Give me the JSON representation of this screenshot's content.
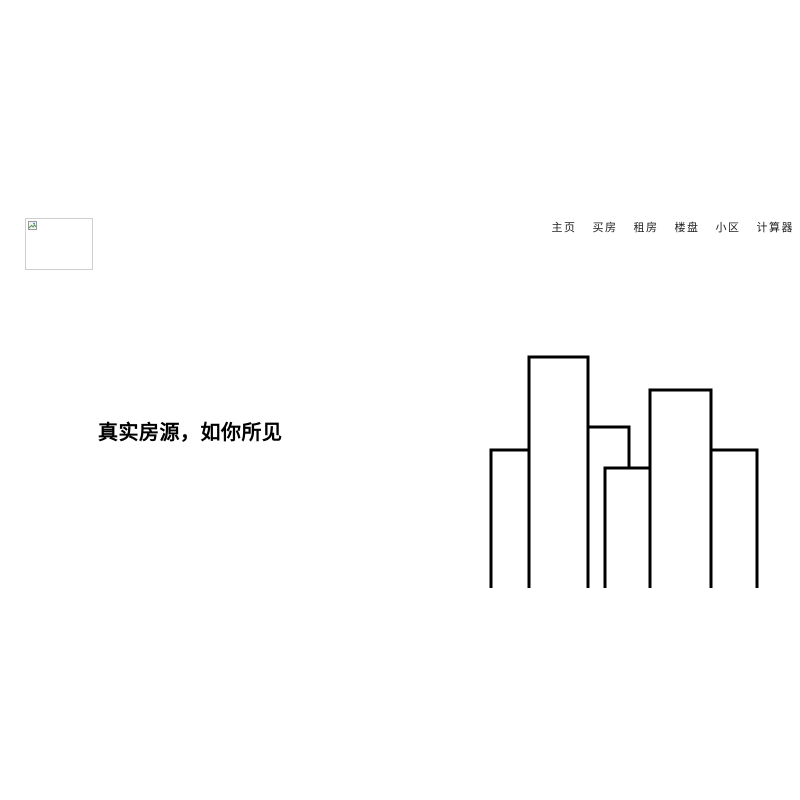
{
  "logo": {
    "alt": "",
    "state": "broken-image"
  },
  "nav": {
    "items": [
      {
        "label": "主页"
      },
      {
        "label": "买房"
      },
      {
        "label": "租房"
      },
      {
        "label": "楼盘"
      },
      {
        "label": "小区"
      },
      {
        "label": "计算器"
      }
    ]
  },
  "hero": {
    "title": "真实房源，如你所见"
  },
  "illustration": {
    "icon": "city-skyline-icon",
    "stroke_color": "#000000"
  },
  "colors": {
    "background": "#ffffff",
    "text": "#000000",
    "nav_text": "#222222"
  }
}
